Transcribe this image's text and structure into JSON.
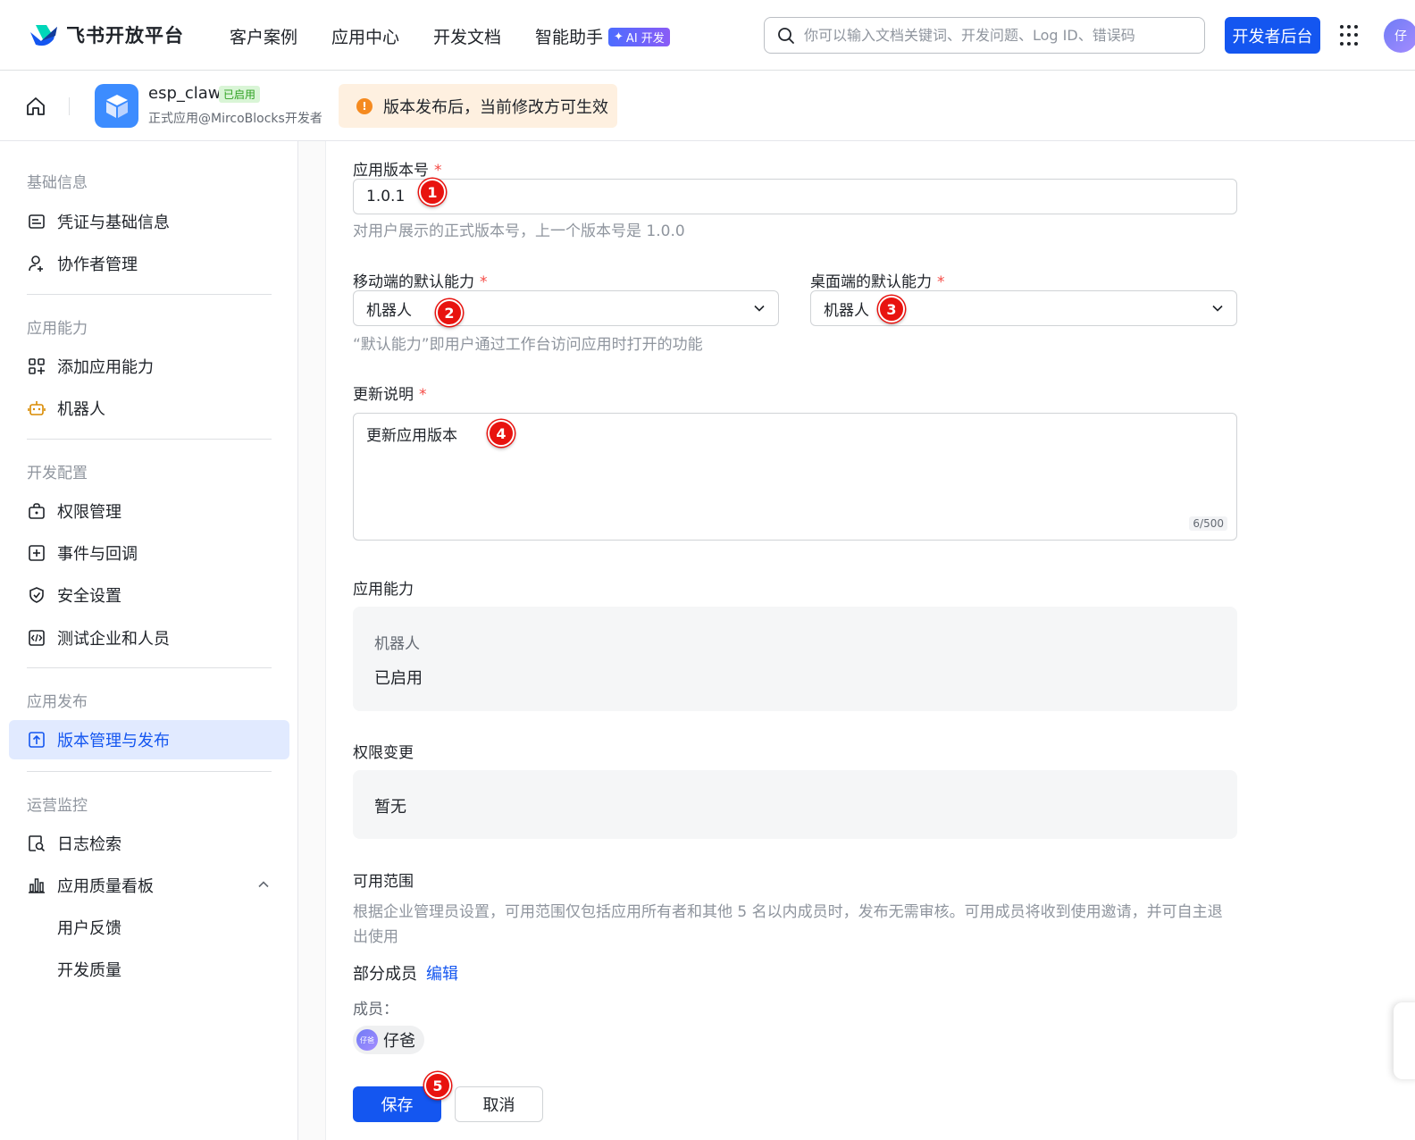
{
  "header": {
    "brand": "飞书开放平台",
    "nav": [
      "客户案例",
      "应用中心",
      "开发文档",
      "智能助手"
    ],
    "ai_badge": "AI 开发",
    "search_placeholder": "你可以输入文档关键词、开发问题、Log ID、错误码",
    "dev_console": "开发者后台",
    "avatar_text": "仔"
  },
  "app": {
    "name": "esp_claw",
    "status": "已启用",
    "subtitle": "正式应用@MircoBlocks开发者",
    "notice": "版本发布后，当前修改方可生效"
  },
  "sidebar": {
    "groups": [
      {
        "title": "基础信息",
        "items": [
          "凭证与基础信息",
          "协作者管理"
        ]
      },
      {
        "title": "应用能力",
        "items": [
          "添加应用能力",
          "机器人"
        ]
      },
      {
        "title": "开发配置",
        "items": [
          "权限管理",
          "事件与回调",
          "安全设置",
          "测试企业和人员"
        ]
      },
      {
        "title": "应用发布",
        "items": [
          "版本管理与发布"
        ]
      },
      {
        "title": "运营监控",
        "items": [
          "日志检索",
          "应用质量看板",
          "用户反馈",
          "开发质量"
        ]
      }
    ]
  },
  "form": {
    "version_label": "应用版本号",
    "version_value": "1.0.1",
    "version_hint": "对用户展示的正式版本号，上一个版本号是 1.0.0",
    "mobile_label": "移动端的默认能力",
    "mobile_value": "机器人",
    "desktop_label": "桌面端的默认能力",
    "desktop_value": "机器人",
    "default_hint": "“默认能力”即用户通过工作台访问应用时打开的功能",
    "notes_label": "更新说明",
    "notes_value": "更新应用版本",
    "notes_counter": "6/500",
    "capability_label": "应用能力",
    "capability_name": "机器人",
    "capability_status": "已启用",
    "permission_label": "权限变更",
    "permission_value": "暂无",
    "scope_label": "可用范围",
    "scope_hint": "根据企业管理员设置，可用范围仅包括应用所有者和其他 5 名以内成员时，发布无需审核。可用成员将收到使用邀请，并可自主退出使用",
    "scope_mode": "部分成员",
    "scope_edit": "编辑",
    "members_label": "成员：",
    "member_name": "仔爸",
    "member_avatar": "仔爸",
    "save": "保存",
    "cancel": "取消"
  },
  "markers": [
    "1",
    "2",
    "3",
    "4",
    "5"
  ]
}
